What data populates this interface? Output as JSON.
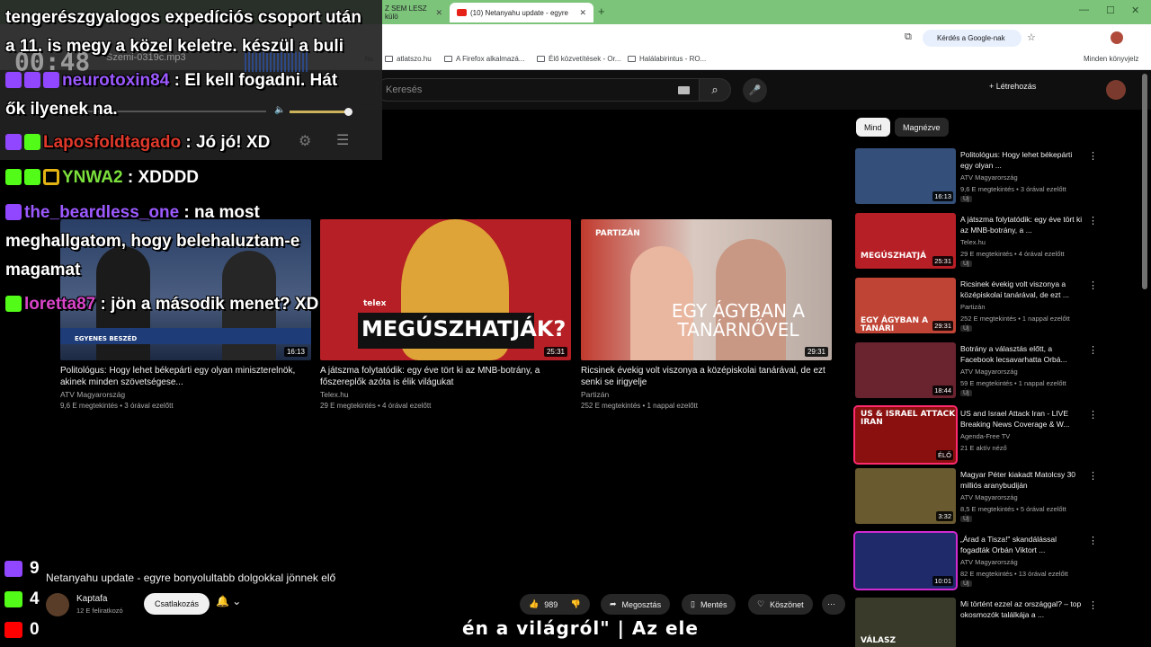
{
  "browser": {
    "tabs": [
      {
        "label": "Z SEM LESZ külö"
      },
      {
        "label": "(10) Netanyahu update - egyre"
      }
    ],
    "address_pill": "Kérdés a Google-nak",
    "bookmarks": [
      "hu",
      "atlatszo.hu",
      "A Firefox alkalmazá...",
      "Élő közvetítések - Or...",
      "Halálabirintus - RO..."
    ],
    "other_bookmarks": "Minden könyvjelz"
  },
  "youtube": {
    "search_placeholder": "Keresés",
    "create_label": "Létrehozás",
    "video_title": "Netanyahu update - egyre bonyolultabb dolgokkal jönnek elő",
    "channel": {
      "name": "Kaptafa",
      "subs": "12 E feliratkozó"
    },
    "join_label": "Csatlakozás",
    "likes": "989",
    "share_label": "Megosztás",
    "save_label": "Mentés",
    "thanks_label": "Köszönet",
    "chips": [
      "Mind",
      "Magnézve"
    ]
  },
  "endscreen": [
    {
      "title": "Politológus: Hogy lehet békepárti egy olyan miniszterelnök, akinek minden szövetségese...",
      "channel": "ATV Magyarország",
      "meta": "9,6 E megtekintés • 3 órával ezelőtt",
      "duration": "16:13",
      "thumb_text": "EGYENES BESZÉD",
      "color": "#3a5a8a"
    },
    {
      "title": "A játszma folytatódik: egy éve tört ki az MNB-botrány, a főszereplők azóta is élik világukat",
      "channel": "Telex.hu",
      "meta": "29 E megtekintés • 4 órával ezelőtt",
      "duration": "25:31",
      "thumb_text": "MEGÚSZHATJÁK?",
      "thumb_sub": "telex",
      "color": "#b61f25"
    },
    {
      "title": "Ricsinek évekig volt viszonya a középiskolai tanárával, de ezt senki se irigyelje",
      "channel": "Partizán",
      "meta": "252 E megtekintés • 1 nappal ezelőtt",
      "duration": "29:31",
      "thumb_text": "EGY ÁGYBAN A TANÁRNŐVEL",
      "thumb_sub": "PARTIZÁN",
      "color": "#c23a2e"
    }
  ],
  "recommendations": [
    {
      "title": "Politológus: Hogy lehet békepárti egy olyan ...",
      "channel": "ATV Magyarország",
      "meta": "9,6 E megtekintés • 3 órával ezelőtt",
      "duration": "16:13",
      "badge": "Új",
      "color": "#34507a",
      "thumb_text": ""
    },
    {
      "title": "A játszma folytatódik: egy éve tört ki az MNB-botrány, a ...",
      "channel": "Telex.hu",
      "meta": "29 E megtekintés • 4 órával ezelőtt",
      "duration": "25:31",
      "badge": "Új",
      "color": "#b61f25",
      "thumb_text": "MEGÚSZHATJÁ"
    },
    {
      "title": "Ricsinek évekig volt viszonya a középiskolai tanárával, de ezt ...",
      "channel": "Partizán",
      "meta": "252 E megtekintés • 1 nappal ezelőtt",
      "duration": "29:31",
      "badge": "Új",
      "color": "#c04436",
      "thumb_text": "EGY ÁGYBAN A TANÁRI"
    },
    {
      "title": "Botrány a választás előtt, a Facebook lecsavarhatta Orbá...",
      "channel": "ATV Magyarország",
      "meta": "59 E megtekintés • 1 nappal ezelőtt",
      "duration": "18:44",
      "badge": "Új",
      "color": "#6a2430",
      "thumb_text": ""
    },
    {
      "title": "US and Israel Attack Iran - LIVE Breaking News Coverage & W...",
      "channel": "Agenda-Free TV",
      "meta": "21 E aktív néző",
      "duration": "ÉLŐ",
      "badge": "",
      "color": "#8a1010",
      "thumb_text": "US & ISRAEL ATTACK IRAN"
    },
    {
      "title": "Magyar Péter kiakadt Matolcsy 30 milliós aranybudiján",
      "channel": "ATV Magyarország",
      "meta": "8,5 E megtekintés • 5 órával ezelőtt",
      "duration": "3:32",
      "badge": "Új",
      "color": "#6a5a30",
      "thumb_text": ""
    },
    {
      "title": "„Árad a Tisza!\" skandálással fogadták Orbán Viktort ...",
      "channel": "ATV Magyarország",
      "meta": "82 E megtekintés • 13 órával ezelőtt",
      "duration": "10:01",
      "badge": "Új",
      "color": "#1f2a6a",
      "thumb_text": ""
    },
    {
      "title": "Mi történt ezzel az országgal? – top okosmozók találkája a ...",
      "channel": "",
      "meta": "",
      "duration": "",
      "badge": "",
      "color": "#3a3a2a",
      "thumb_text": "VÁLASZ"
    }
  ],
  "overlay": {
    "timer": "00:48",
    "file": "Szemi-0319c.mp3",
    "chat": [
      {
        "badges": [],
        "user": "",
        "user_color": "#ffffff",
        "message": "tengerészgyalogos expedíciós csoport után"
      },
      {
        "badges": [],
        "user": "",
        "user_color": "#ffffff",
        "message": "a 11. is megy a közel keletre. készül a buli"
      },
      {
        "badges": [
          "tw",
          "star",
          "star"
        ],
        "user": "neurotoxin84",
        "user_color": "#9b59ff",
        "message": ": El kell fogadni. Hát"
      },
      {
        "badges": [],
        "user": "",
        "user_color": "#ffffff",
        "message": "ők ilyenek na."
      },
      {
        "badges": [
          "tw",
          "kk"
        ],
        "user": "Laposfoldtagado",
        "user_color": "#e0392b",
        "message": ": Jó jó! XD"
      },
      {
        "badges": [
          "kk",
          "kk",
          "gold"
        ],
        "user": "YNWA2",
        "user_color": "#7be03c",
        "message": ": XDDDD"
      },
      {
        "badges": [
          "tw"
        ],
        "user": "the_beardless_one",
        "user_color": "#9b59ff",
        "message": ": na most"
      },
      {
        "badges": [],
        "user": "",
        "user_color": "#ffffff",
        "message": "meghallgatom, hogy belehaluztam-e"
      },
      {
        "badges": [],
        "user": "",
        "user_color": "#ffffff",
        "message": "magamat"
      },
      {
        "badges": [
          "kk"
        ],
        "user": "loretta87",
        "user_color": "#d944c8",
        "message": ": jön a második menet? XD"
      }
    ],
    "counters": [
      {
        "platform": "twitch",
        "count": "9",
        "color": "#9146ff"
      },
      {
        "platform": "kick",
        "count": "4",
        "color": "#53fc18"
      },
      {
        "platform": "youtube",
        "count": "0",
        "color": "#ff0000"
      }
    ],
    "ticker": "én a világról\" | Az ele"
  }
}
